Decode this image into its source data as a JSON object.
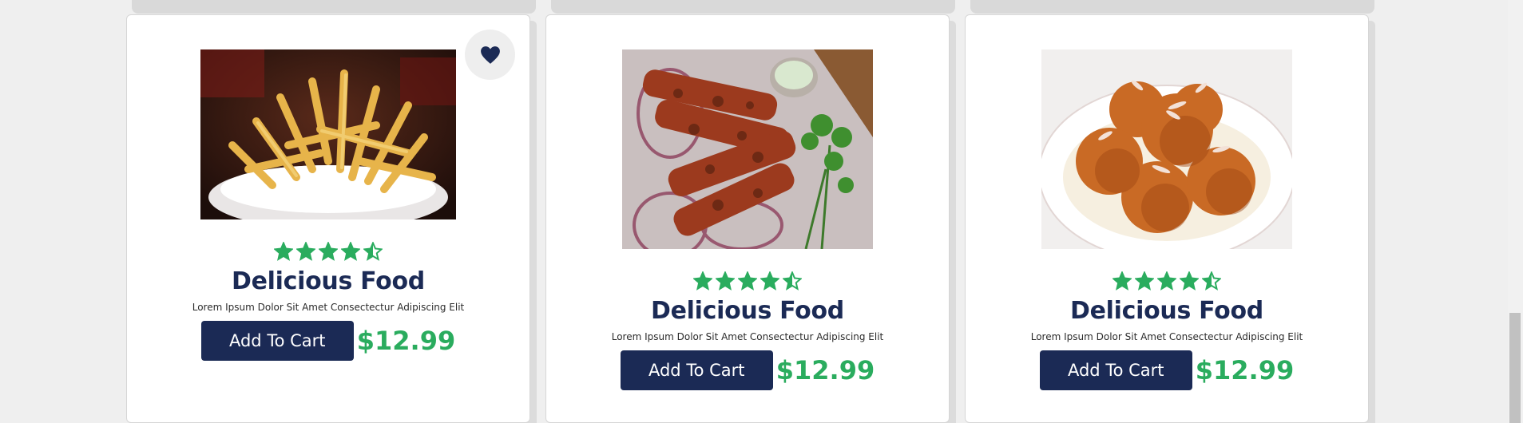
{
  "colors": {
    "navy": "#1b2a55",
    "green": "#2aac5e",
    "page_bg": "#efefef"
  },
  "products": [
    {
      "title": "Delicious Food",
      "description": "Lorem Ipsum Dolor Sit Amet Consectectur Adipiscing Elit",
      "button_label": "Add To Cart",
      "price": "$12.99",
      "rating": 4.5,
      "image": "french-fries-photo",
      "favorite": true
    },
    {
      "title": "Delicious Food",
      "description": "Lorem Ipsum Dolor Sit Amet Consectectur Adipiscing Elit",
      "button_label": "Add To Cart",
      "price": "$12.99",
      "rating": 4.5,
      "image": "chicken-tikka-skewers-photo",
      "favorite": false
    },
    {
      "title": "Delicious Food",
      "description": "Lorem Ipsum Dolor Sit Amet Consectectur Adipiscing Elit",
      "button_label": "Add To Cart",
      "price": "$12.99",
      "rating": 4.5,
      "image": "gulab-jamun-photo",
      "favorite": false
    }
  ]
}
